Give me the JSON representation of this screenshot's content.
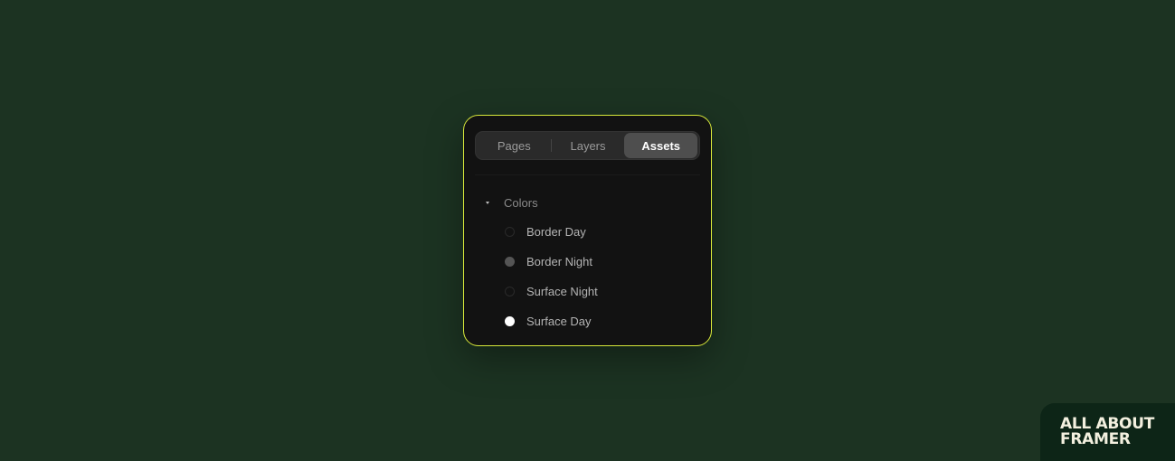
{
  "tabs": {
    "items": [
      {
        "label": "Pages"
      },
      {
        "label": "Layers"
      },
      {
        "label": "Assets"
      }
    ],
    "active": "Assets"
  },
  "assets": {
    "group_label": "Colors",
    "caret_icon": "caret-down-icon",
    "colors": [
      {
        "label": "Border Day",
        "swatch_fill": "#121212",
        "swatch_border": "#2a2a2a"
      },
      {
        "label": "Border Night",
        "swatch_fill": "#555555",
        "swatch_border": "#555555"
      },
      {
        "label": "Surface Night",
        "swatch_fill": "#121212",
        "swatch_border": "#2a2a2a"
      },
      {
        "label": "Surface Day",
        "swatch_fill": "#ffffff",
        "swatch_border": "#ffffff"
      }
    ]
  },
  "branding": {
    "line1": "ALL ABOUT",
    "line2": "FRAMER"
  },
  "colors": {
    "background": "#1c3322",
    "panel": "#121212",
    "panel_border": "#d8e83a",
    "badge": "#0d2517"
  }
}
